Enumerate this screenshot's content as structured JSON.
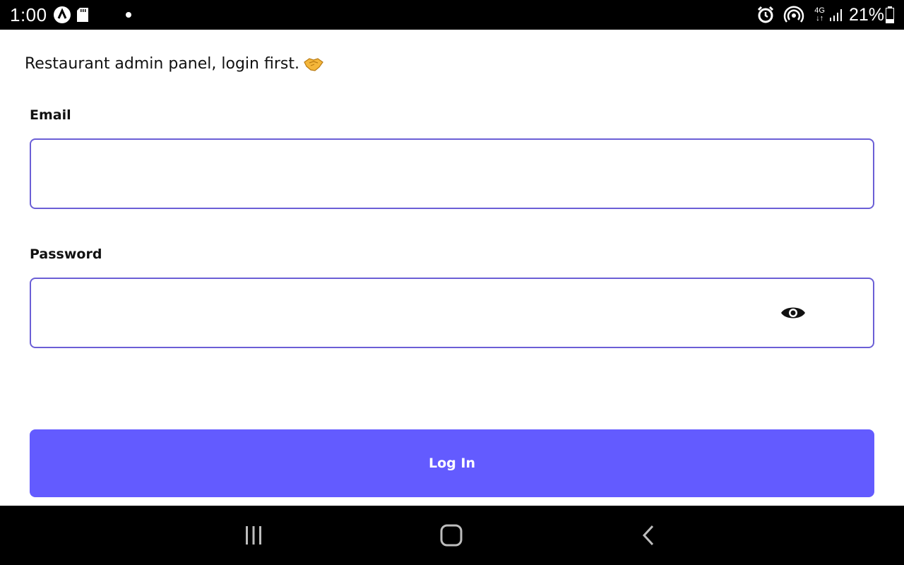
{
  "status_bar": {
    "time": "1:00",
    "network_type": "4G",
    "battery_percent": "21%"
  },
  "intro": {
    "text": "Restaurant admin panel, login first.",
    "emoji_icon": "handshake-icon"
  },
  "form": {
    "email": {
      "label": "Email",
      "value": "",
      "placeholder": ""
    },
    "password": {
      "label": "Password",
      "value": "",
      "placeholder": "",
      "toggle_icon": "eye-icon"
    },
    "submit_label": "Log In"
  },
  "nav_bar": {
    "icons": [
      "recents-icon",
      "home-icon",
      "back-icon"
    ]
  },
  "colors": {
    "accent": "#635bff",
    "input_border": "#6b5fd6",
    "status_bar_bg": "#000000"
  }
}
